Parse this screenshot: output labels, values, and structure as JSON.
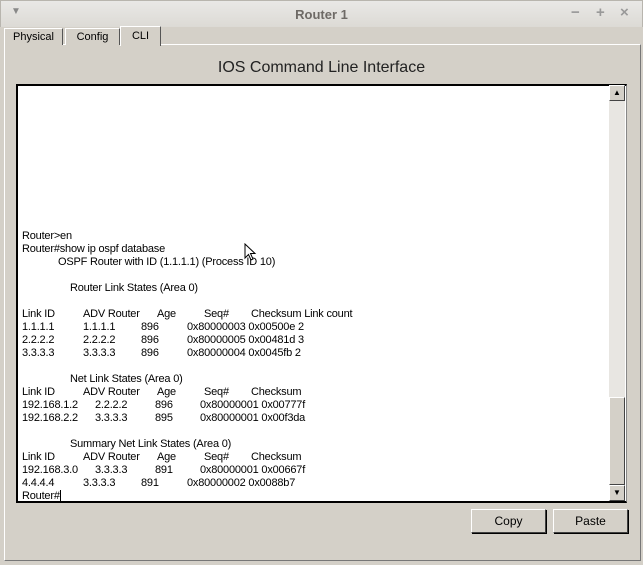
{
  "window": {
    "title": "Router 1"
  },
  "tabs": [
    {
      "label": "Physical"
    },
    {
      "label": "Config"
    },
    {
      "label": "CLI",
      "active": true
    }
  ],
  "heading": "IOS Command Line Interface",
  "terminal": {
    "prompt_en": "Router>en",
    "command": "Router#show ip ospf database",
    "ospf_header": "OSPF Router with ID (1.1.1.1) (Process ID 10)",
    "router_section": {
      "title": "Router Link States (Area 0)",
      "headers": [
        "Link ID",
        "ADV Router",
        "Age",
        "Seq#",
        "Checksum Link count"
      ],
      "rows": [
        [
          "1.1.1.1",
          "1.1.1.1",
          "896",
          "0x80000003 0x00500e 2"
        ],
        [
          "2.2.2.2",
          "2.2.2.2",
          "896",
          "0x80000005 0x00481d 3"
        ],
        [
          "3.3.3.3",
          "3.3.3.3",
          "896",
          "0x80000004 0x0045fb 2"
        ]
      ]
    },
    "net_section": {
      "title": "Net Link States (Area 0)",
      "headers": [
        "Link ID",
        "ADV Router",
        "Age",
        "Seq#",
        "Checksum"
      ],
      "rows": [
        [
          "192.168.1.2",
          "2.2.2.2",
          "896",
          "0x80000001 0x00777f"
        ],
        [
          "192.168.2.2",
          "3.3.3.3",
          "895",
          "0x80000001 0x00f3da"
        ]
      ]
    },
    "summary_section": {
      "title": "Summary Net Link States (Area 0)",
      "headers": [
        "Link ID",
        "ADV Router",
        "Age",
        "Seq#",
        "Checksum"
      ],
      "rows": [
        [
          "192.168.3.0",
          "3.3.3.3",
          "891",
          "0x80000001 0x00667f"
        ],
        [
          "4.4.4.4",
          "3.3.3.3",
          "891",
          "0x80000002 0x0088b7"
        ]
      ]
    },
    "final_prompt": "Router#"
  },
  "buttons": {
    "copy": "Copy",
    "paste": "Paste"
  }
}
